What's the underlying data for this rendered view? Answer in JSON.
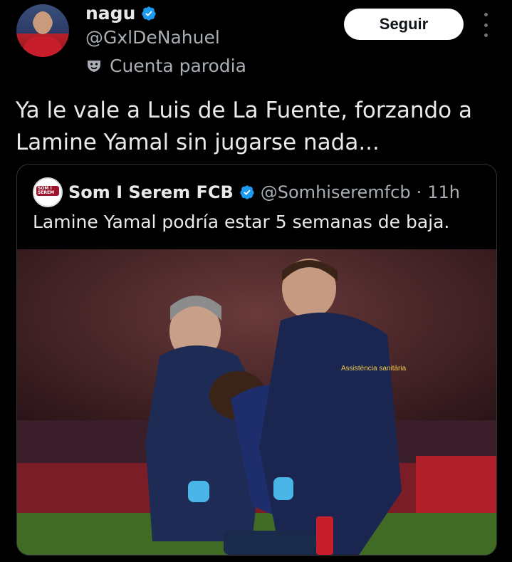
{
  "author": {
    "name": "nagu",
    "handle": "@GxlDeNahuel",
    "label": "Cuenta parodia",
    "verified_icon": "verified-badge-icon",
    "label_icon": "parody-mask-icon"
  },
  "actions": {
    "follow_label": "Seguir",
    "more_icon": "more-options-icon"
  },
  "tweet": {
    "text_line1": "Ya le vale a Luis de La Fuente, forzando a",
    "text_line2": "Lamine Yamal sin jugarse nada..."
  },
  "quoted": {
    "name": "Som I Serem FCB",
    "handle": "@Somhiseremfcb",
    "separator": "·",
    "time": "11h",
    "text": "Lamine Yamal podría estar 5 semanas de baja.",
    "avatar_text_1": "SOM I",
    "avatar_text_2": "SEREM",
    "photo_overlay_text": "Assistència sanitària"
  },
  "colors": {
    "background": "#000000",
    "text": "#e7e9ea",
    "secondary": "#a8aeb3",
    "verified_blue": "#1d9bf0",
    "follow_bg": "#ffffff"
  }
}
